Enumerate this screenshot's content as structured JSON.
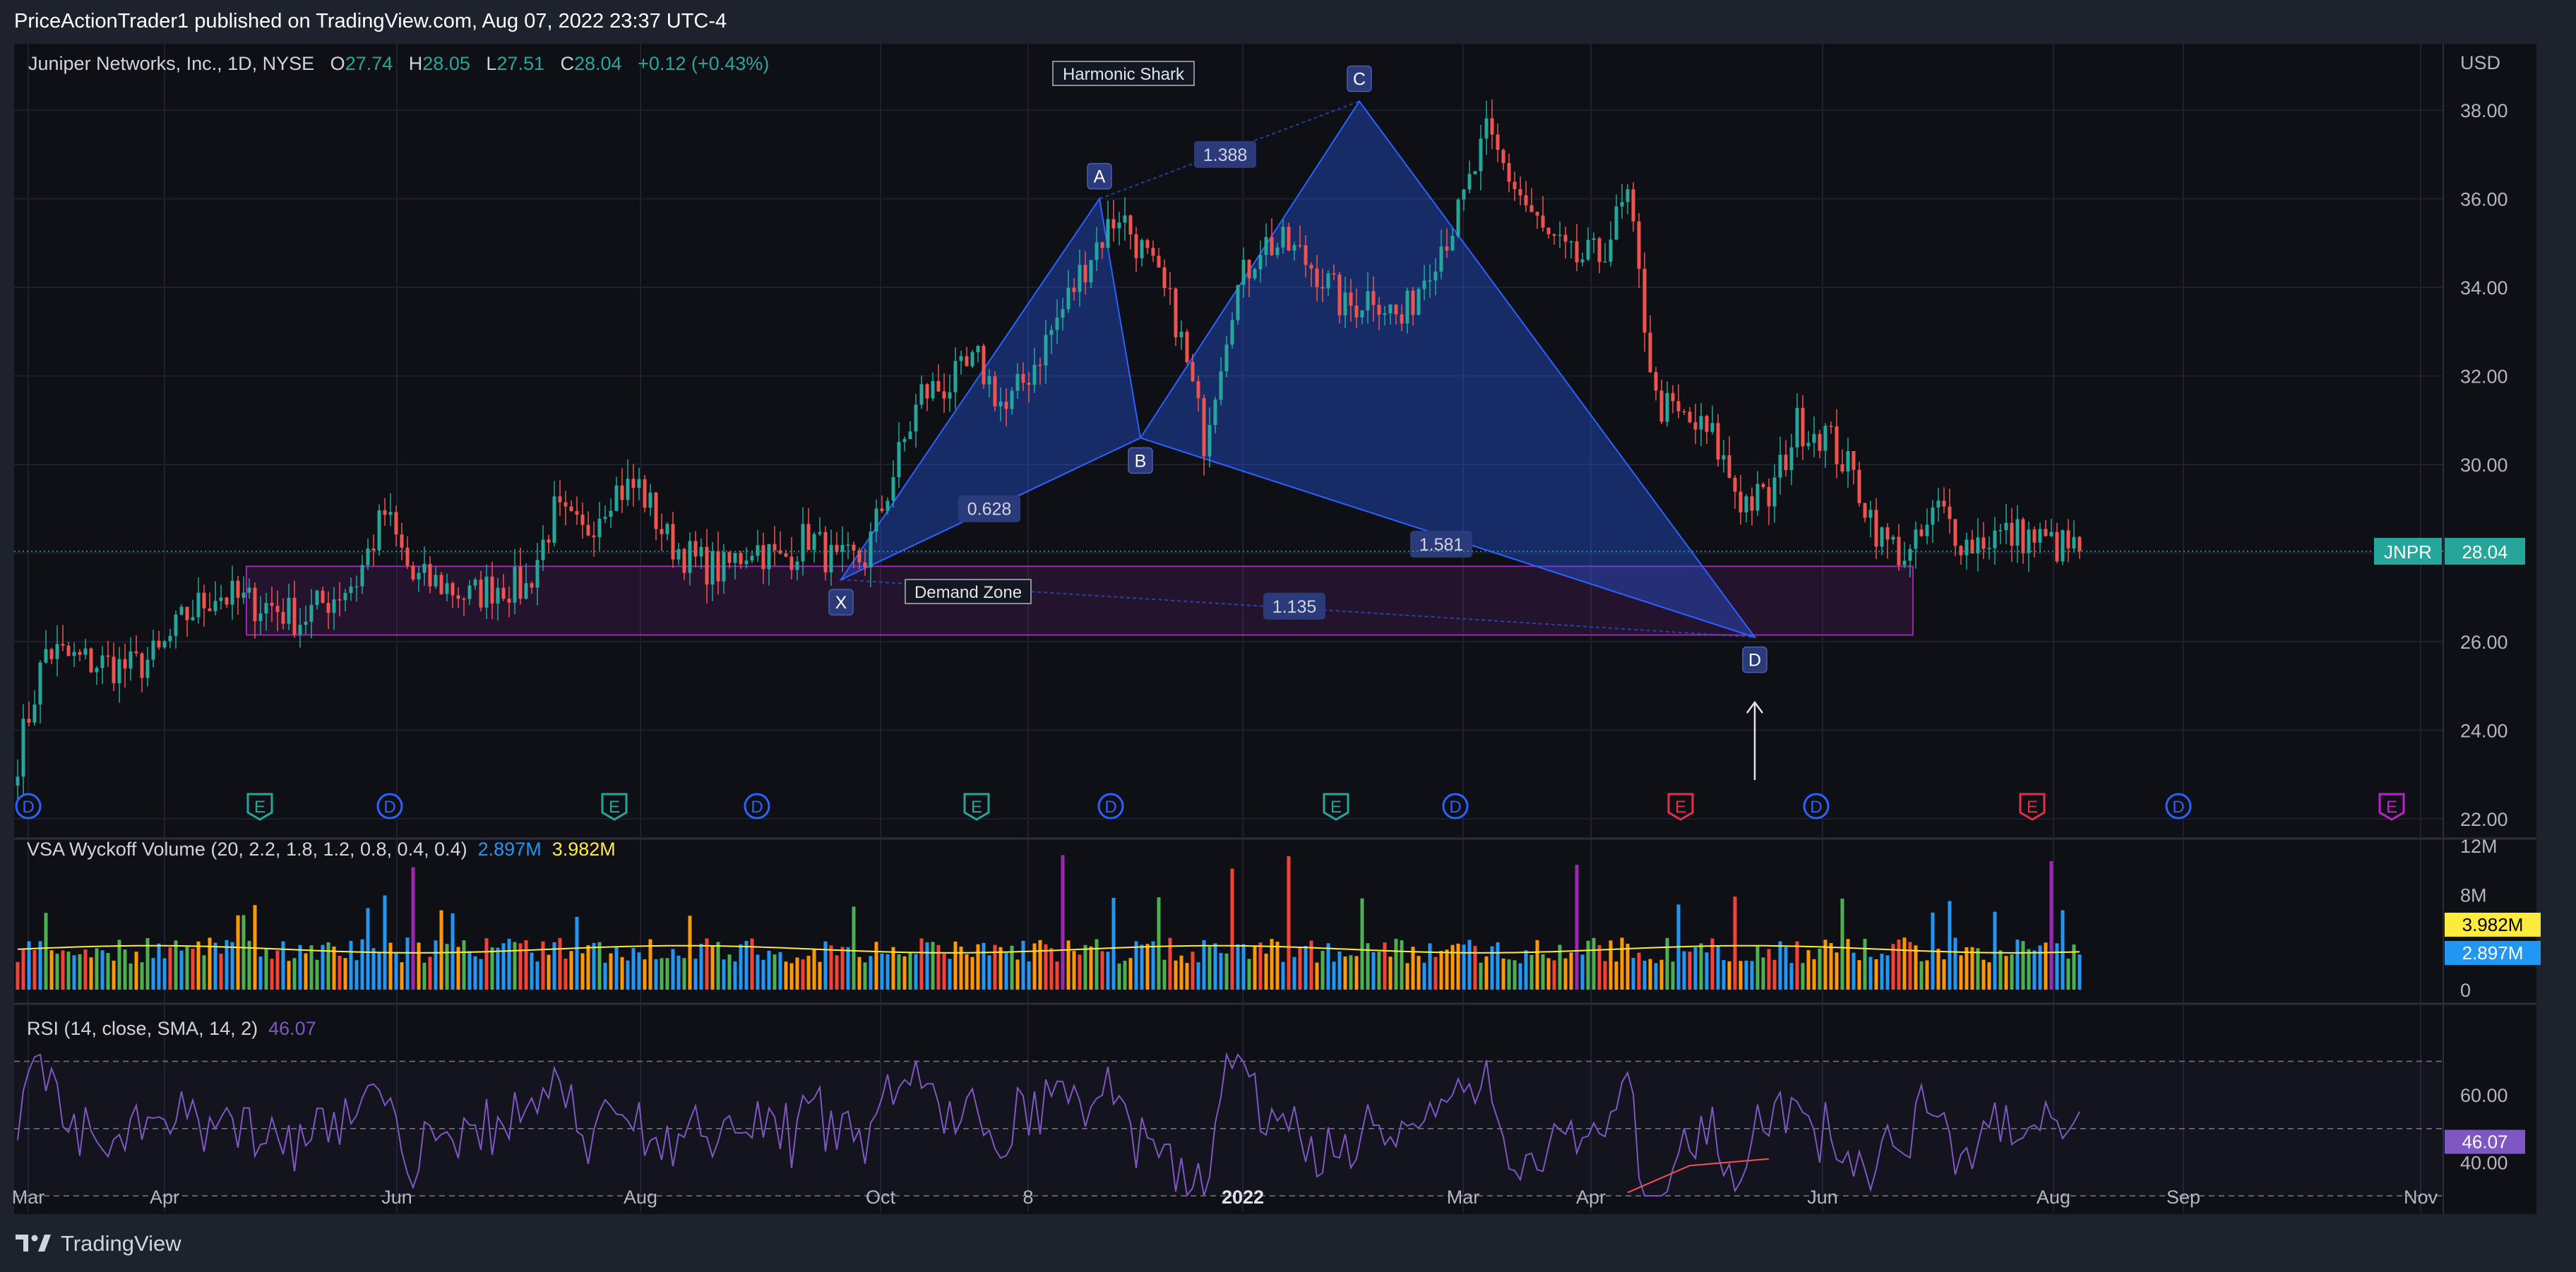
{
  "publish_line": "PriceActionTrader1 published on TradingView.com, Aug 07, 2022 23:37 UTC-4",
  "brand": {
    "name": "TradingView",
    "logo_icon": "tradingview-logo-icon"
  },
  "legend": {
    "symbol": "Juniper Networks, Inc., 1D, NYSE",
    "open_label": "O",
    "open": "27.74",
    "high_label": "H",
    "high": "28.05",
    "low_label": "L",
    "low": "27.51",
    "close_label": "C",
    "close": "28.04",
    "change": "+0.12 (+0.43%)"
  },
  "colors": {
    "up": "#26a69a",
    "down": "#ef5350",
    "pattern": "#2962ff",
    "zone": "#9c27b0",
    "rsi": "#7e57c2",
    "vol_ma": "#ffeb3b",
    "vol_blue": "#2196f3",
    "vol_green": "#4caf50",
    "vol_orange": "#ff9800",
    "vol_red": "#f44336",
    "vol_purple": "#9c27b0",
    "vol_label": "#2196f3"
  },
  "chart_data": {
    "type": "candlestick",
    "symbol": "JNPR",
    "y_axis": {
      "unit": "USD",
      "ticks": [
        22,
        24,
        26,
        28,
        30,
        32,
        34,
        36,
        38
      ],
      "range": [
        21.6,
        39.5
      ]
    },
    "x_axis_labels": [
      "Mar",
      "Apr",
      "Jun",
      "Aug",
      "Oct",
      "8",
      "2022",
      "Mar",
      "Apr",
      "Jun",
      "Aug",
      "Sep",
      "Nov"
    ],
    "last_price": 28.04,
    "price_tag": {
      "symbol": "JNPR",
      "value": "28.04"
    },
    "price_path": [
      [
        0,
        23.4
      ],
      [
        20,
        25.8
      ],
      [
        40,
        25.6
      ],
      [
        60,
        25.5
      ],
      [
        80,
        25.4
      ],
      [
        100,
        25.7
      ],
      [
        120,
        26.6
      ],
      [
        140,
        27.1
      ],
      [
        160,
        26.9
      ],
      [
        180,
        26.8
      ],
      [
        200,
        26.5
      ],
      [
        240,
        27.4
      ],
      [
        260,
        28.9
      ],
      [
        280,
        27.4
      ],
      [
        300,
        27.3
      ],
      [
        320,
        27.0
      ],
      [
        340,
        27.3
      ],
      [
        360,
        27.2
      ],
      [
        380,
        28.9
      ],
      [
        400,
        28.4
      ],
      [
        420,
        29.4
      ],
      [
        440,
        29.5
      ],
      [
        460,
        28.3
      ],
      [
        480,
        27.8
      ],
      [
        500,
        27.6
      ],
      [
        520,
        28.2
      ],
      [
        540,
        27.8
      ],
      [
        560,
        28.4
      ],
      [
        580,
        27.7
      ],
      [
        600,
        27.9
      ],
      [
        620,
        29.8
      ],
      [
        640,
        31.6
      ],
      [
        660,
        31.8
      ],
      [
        680,
        32.3
      ],
      [
        700,
        31.2
      ],
      [
        720,
        32.3
      ],
      [
        740,
        33.5
      ],
      [
        760,
        34.8
      ],
      [
        780,
        35.7
      ],
      [
        800,
        34.6
      ],
      [
        820,
        33.3
      ],
      [
        840,
        30.6
      ],
      [
        860,
        33.7
      ],
      [
        880,
        35.0
      ],
      [
        900,
        34.9
      ],
      [
        920,
        34.4
      ],
      [
        940,
        33.5
      ],
      [
        960,
        33.9
      ],
      [
        980,
        33.2
      ],
      [
        1000,
        34.6
      ],
      [
        1020,
        35.6
      ],
      [
        1040,
        37.4
      ],
      [
        1060,
        36.3
      ],
      [
        1080,
        35.2
      ],
      [
        1100,
        34.6
      ],
      [
        1120,
        34.7
      ],
      [
        1140,
        36.0
      ],
      [
        1160,
        31.4
      ],
      [
        1180,
        31.0
      ],
      [
        1200,
        30.6
      ],
      [
        1220,
        29.2
      ],
      [
        1240,
        29.2
      ],
      [
        1260,
        30.9
      ],
      [
        1280,
        30.7
      ],
      [
        1300,
        29.7
      ],
      [
        1320,
        28.3
      ],
      [
        1340,
        27.9
      ],
      [
        1360,
        29.0
      ],
      [
        1380,
        28.2
      ],
      [
        1400,
        28.4
      ],
      [
        1420,
        28.4
      ],
      [
        1440,
        28.2
      ],
      [
        1460,
        28.04
      ]
    ],
    "earnings_markers": [
      "D",
      "E",
      "D",
      "E",
      "D",
      "E",
      "D",
      "E",
      "D",
      "E",
      "D",
      "E",
      "D",
      "E"
    ],
    "harmonic_pattern": {
      "title": "Harmonic Shark",
      "points": [
        {
          "label": "X",
          "x": 583,
          "price": 27.4
        },
        {
          "label": "A",
          "x": 766,
          "price": 36.0
        },
        {
          "label": "B",
          "x": 795,
          "price": 30.6
        },
        {
          "label": "C",
          "x": 950,
          "price": 38.2
        },
        {
          "label": "D",
          "x": 1230,
          "price": 26.1
        }
      ],
      "ratios": [
        {
          "label": "0.628",
          "x": 688,
          "price": 29.0
        },
        {
          "label": "1.388",
          "x": 855,
          "price": 37.0
        },
        {
          "label": "1.581",
          "x": 1008,
          "price": 28.2
        },
        {
          "label": "1.135",
          "x": 904,
          "price": 26.8
        }
      ]
    },
    "demand_zone": {
      "label": "Demand Zone",
      "top": 27.7,
      "bottom": 26.15,
      "x_start": 162,
      "x_end": 1342
    }
  },
  "volume_panel": {
    "legend": "VSA Wyckoff Volume (20, 2.2, 1.8, 1.2, 0.8, 0.4, 0.4)",
    "value1": "2.897M",
    "value2": "3.982M",
    "y_ticks": [
      "12M",
      "8M",
      "0"
    ],
    "tag_ma": "3.982M",
    "tag_vol": "2.897M"
  },
  "rsi_panel": {
    "legend": "RSI (14, close, SMA, 14, 2)",
    "value": "46.07",
    "y_ticks": [
      "60.00",
      "40.00"
    ],
    "tag": "46.07",
    "levels": [
      30,
      50,
      70
    ]
  }
}
